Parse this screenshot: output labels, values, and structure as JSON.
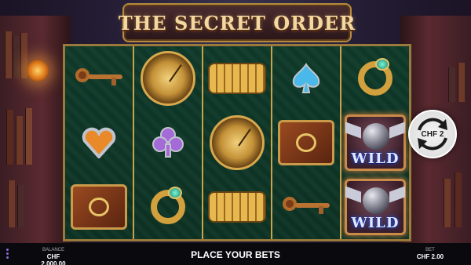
{
  "game": {
    "title": "THE SECRET ORDER"
  },
  "reels": [
    [
      "key",
      "heart",
      "book"
    ],
    [
      "pocket-watch",
      "club",
      "ring"
    ],
    [
      "cryptex",
      "pocket-watch",
      "cryptex"
    ],
    [
      "spade",
      "book",
      "key"
    ],
    [
      "ring",
      "wild",
      "wild"
    ]
  ],
  "wild_label": "WILD",
  "spin": {
    "label": "CHF 2"
  },
  "footer": {
    "balance_label": "BALANCE",
    "balance_value": "CHF 2,000.00",
    "message": "PLACE YOUR BETS",
    "bet_label": "BET",
    "bet_value": "CHF 2.00"
  },
  "colors": {
    "reel_bg": "#123b2a",
    "frame_gold": "#c9a24a",
    "wild_text": "#dfe6ff",
    "bottom_bar": "#0a0a0e"
  }
}
